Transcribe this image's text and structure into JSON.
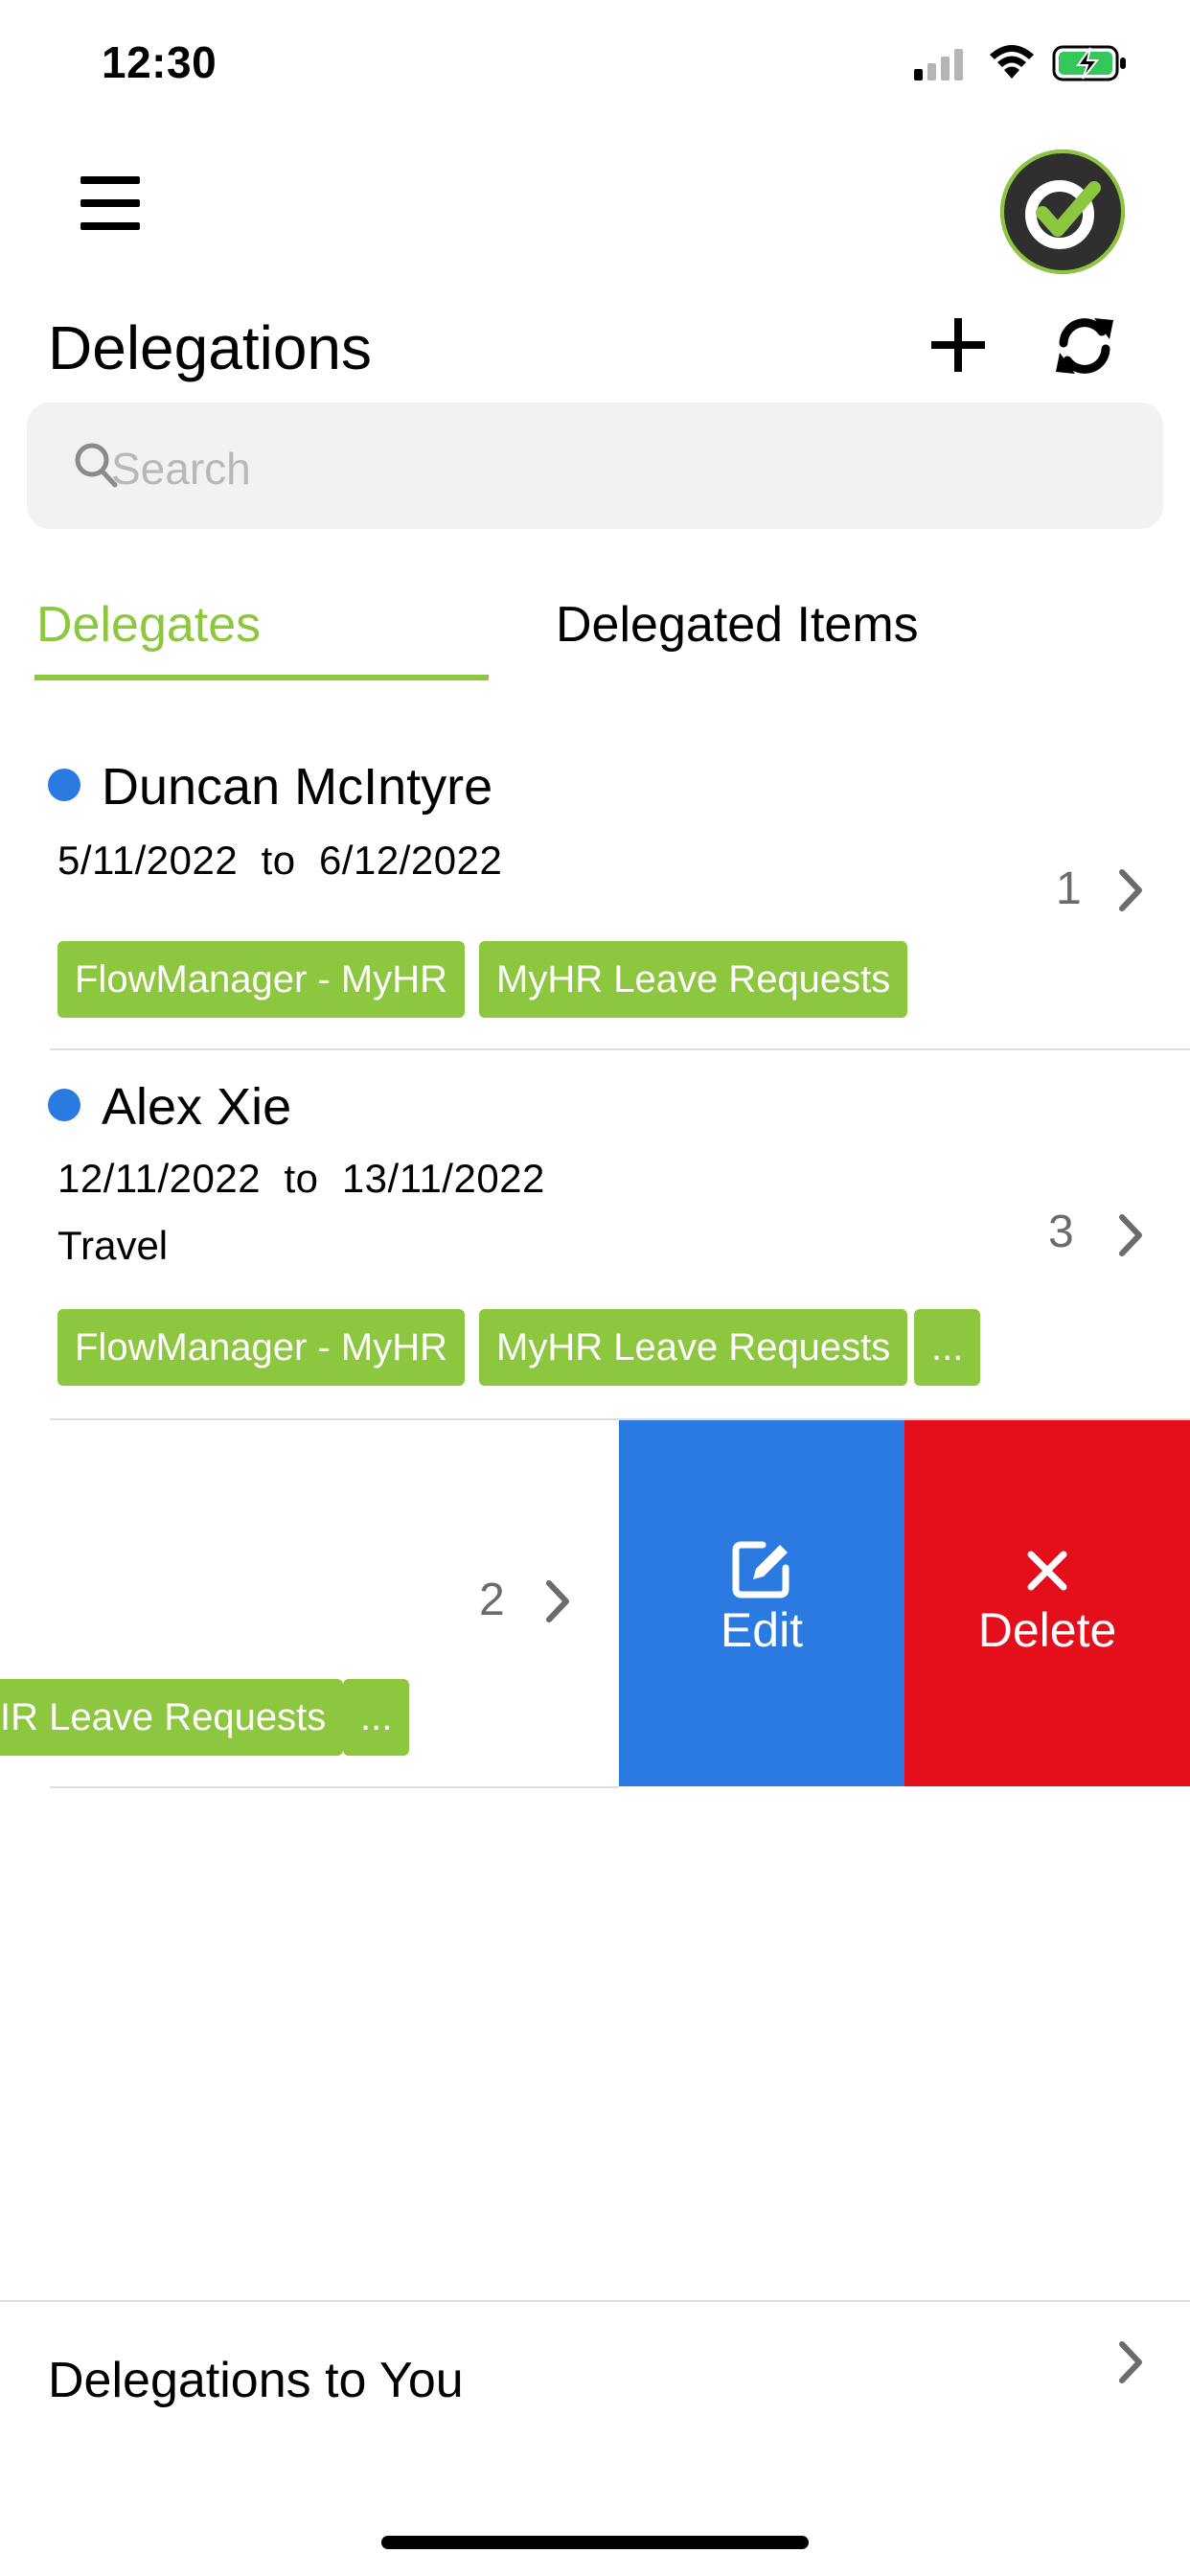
{
  "status_bar": {
    "time": "12:30"
  },
  "header": {
    "title": "Delegations"
  },
  "search": {
    "placeholder": "Search"
  },
  "tabs": [
    {
      "label": "Delegates",
      "active": true
    },
    {
      "label": "Delegated Items",
      "active": false
    }
  ],
  "delegations": [
    {
      "name": "Duncan McIntyre",
      "start": "5/11/2022",
      "to": "to",
      "end": "6/12/2022",
      "reason": "",
      "count": "1",
      "tags": [
        "FlowManager - MyHR",
        "MyHR Leave Requests"
      ]
    },
    {
      "name": "Alex Xie",
      "start": "12/11/2022",
      "to": "to",
      "end": "13/11/2022",
      "reason": "Travel",
      "count": "3",
      "tags": [
        "FlowManager - MyHR",
        "MyHR Leave Requests",
        "..."
      ]
    },
    {
      "count": "2",
      "tags": [
        "IR Leave Requests",
        "..."
      ]
    }
  ],
  "swipe_actions": {
    "edit_label": "Edit",
    "delete_label": "Delete"
  },
  "footer": {
    "label": "Delegations to You"
  },
  "colors": {
    "accent": "#8dc63f",
    "blue": "#2a7ae2",
    "red": "#e50e1b"
  }
}
